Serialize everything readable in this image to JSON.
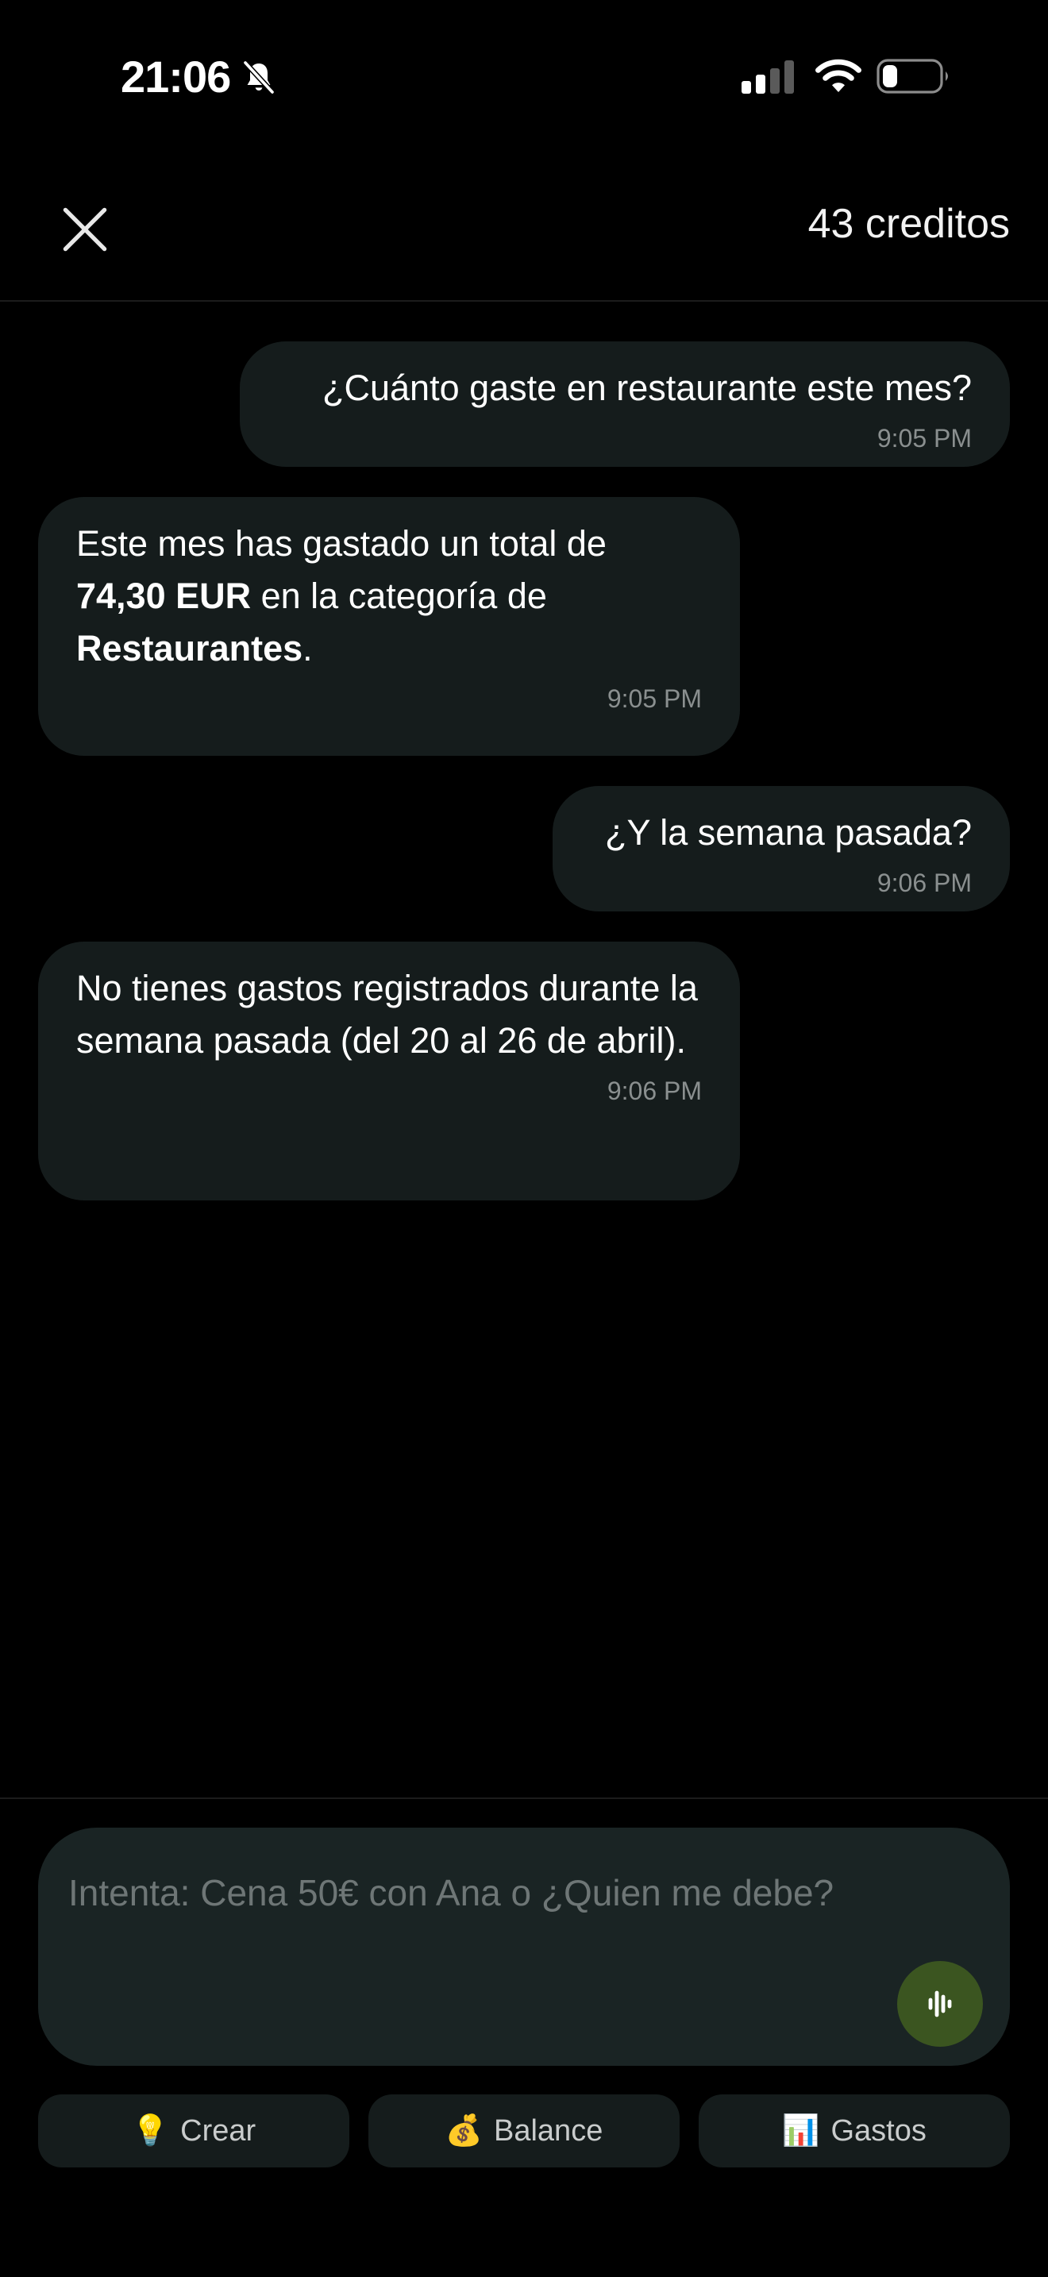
{
  "status_bar": {
    "time": "21:06",
    "icons": [
      "bell-slash-icon",
      "signal-icon",
      "wifi-icon",
      "battery-icon"
    ]
  },
  "header": {
    "close_icon": "close-icon",
    "credits": "43 creditos"
  },
  "messages": [
    {
      "sender": "user",
      "text": "¿Cuánto gaste en restaurante este mes?",
      "time": "9:05 PM"
    },
    {
      "sender": "assistant",
      "parts": {
        "p1": "Este mes has gastado un total de ",
        "amount": "74,30 EUR",
        "p2": " en la categoría de ",
        "category": "Restaurantes",
        "p3": "."
      },
      "time": "9:05 PM"
    },
    {
      "sender": "user",
      "text": "¿Y la semana pasada?",
      "time": "9:06 PM"
    },
    {
      "sender": "assistant",
      "text": "No tienes gastos registrados durante la semana pasada (del 20 al 26 de abril).",
      "time": "9:06 PM"
    }
  ],
  "composer": {
    "placeholder": "Intenta: Cena 50€ con Ana o ¿Quien me debe?",
    "value": "",
    "voice_icon": "voice-wave-icon"
  },
  "quick_actions": [
    {
      "emoji": "💡",
      "label": "Crear",
      "icon": "lightbulb-icon"
    },
    {
      "emoji": "💰",
      "label": "Balance",
      "icon": "money-bag-icon"
    },
    {
      "emoji": "📊",
      "label": "Gastos",
      "icon": "bar-chart-icon"
    }
  ],
  "colors": {
    "background": "#000000",
    "bubble": "#151c1c",
    "composer": "#1a2424",
    "voice_button": "#3b5520",
    "timestamp": "#8a8f8f"
  }
}
